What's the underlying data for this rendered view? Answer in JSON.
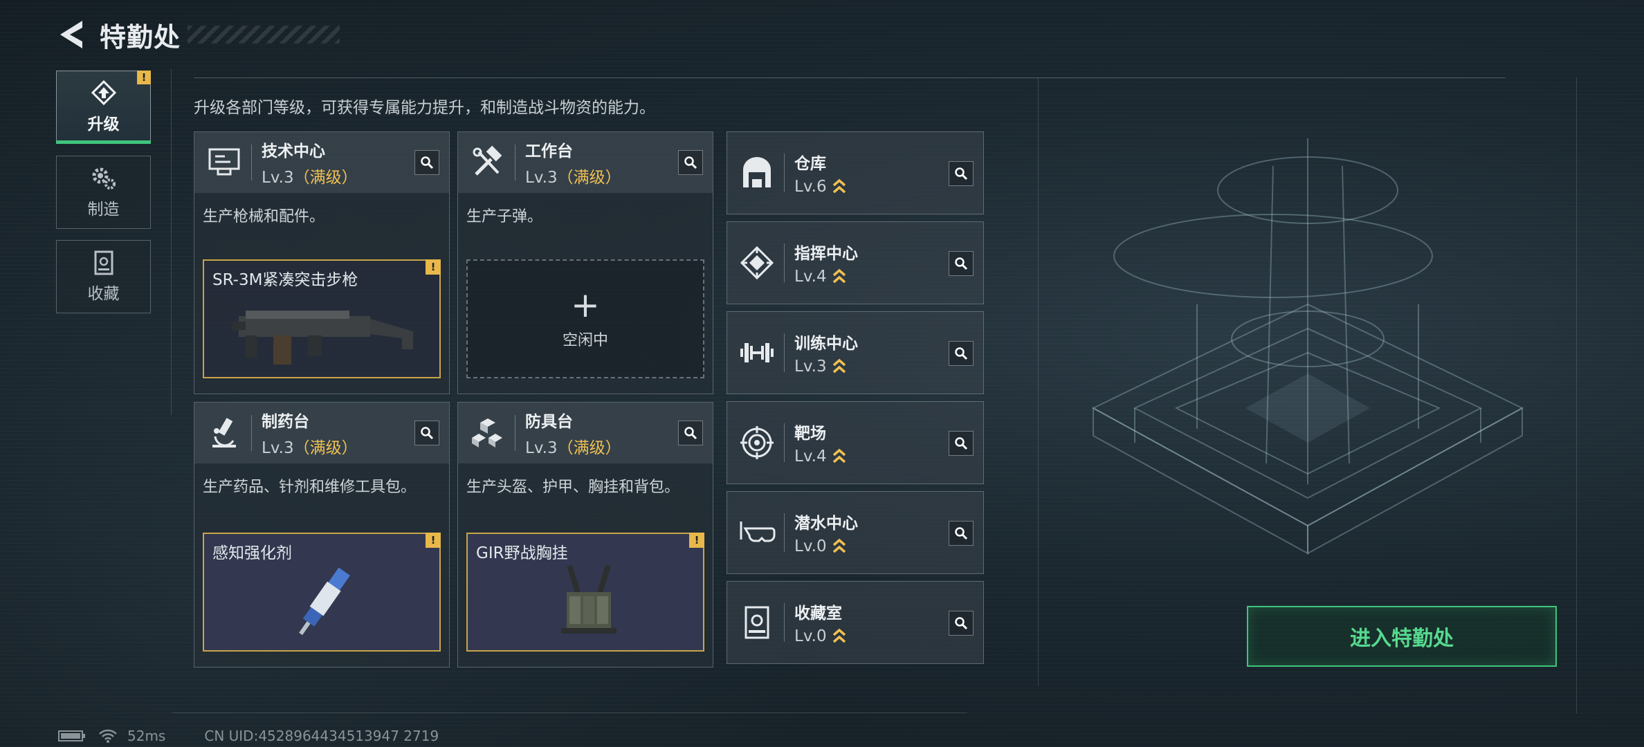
{
  "header": {
    "title": "特勤处"
  },
  "tabs": [
    {
      "label": "升级",
      "active": true,
      "alert": "!"
    },
    {
      "label": "制造",
      "active": false
    },
    {
      "label": "收藏",
      "active": false
    }
  ],
  "subtitle": "升级各部门等级，可获得专属能力提升，和制造战斗物资的能力。",
  "departments": [
    {
      "name": "技术中心",
      "level": "Lv.3",
      "max": "（满级）",
      "desc": "生产枪械和配件。",
      "slot": {
        "item": "SR-3M紧凑突击步枪",
        "alert": "!"
      }
    },
    {
      "name": "工作台",
      "level": "Lv.3",
      "max": "（满级）",
      "desc": "生产子弹。",
      "slot": {
        "plus": "+",
        "idle": "空闲中"
      }
    },
    {
      "name": "制药台",
      "level": "Lv.3",
      "max": "（满级）",
      "desc": "生产药品、针剂和维修工具包。",
      "slot": {
        "item": "感知强化剂",
        "alert": "!"
      }
    },
    {
      "name": "防具台",
      "level": "Lv.3",
      "max": "（满级）",
      "desc": "生产头盔、护甲、胸挂和背包。",
      "slot": {
        "item": "GIR野战胸挂",
        "alert": "!"
      }
    }
  ],
  "facilities": [
    {
      "name": "仓库",
      "level": "Lv.6",
      "icon": "warehouse-icon"
    },
    {
      "name": "指挥中心",
      "level": "Lv.4",
      "icon": "command-icon"
    },
    {
      "name": "训练中心",
      "level": "Lv.3",
      "icon": "dumbbell-icon"
    },
    {
      "name": "靶场",
      "level": "Lv.4",
      "icon": "target-icon"
    },
    {
      "name": "潜水中心",
      "level": "Lv.0",
      "icon": "diving-mask-icon"
    },
    {
      "name": "收藏室",
      "level": "Lv.0",
      "icon": "collection-icon"
    }
  ],
  "enter_button": "进入特勤处",
  "footer": {
    "ping": "52ms",
    "uid": "CN UID:4528964434513947 2719"
  },
  "colors": {
    "accent_green": "#3fc57c",
    "gold": "#f0c052",
    "alert": "#e8b84a"
  }
}
